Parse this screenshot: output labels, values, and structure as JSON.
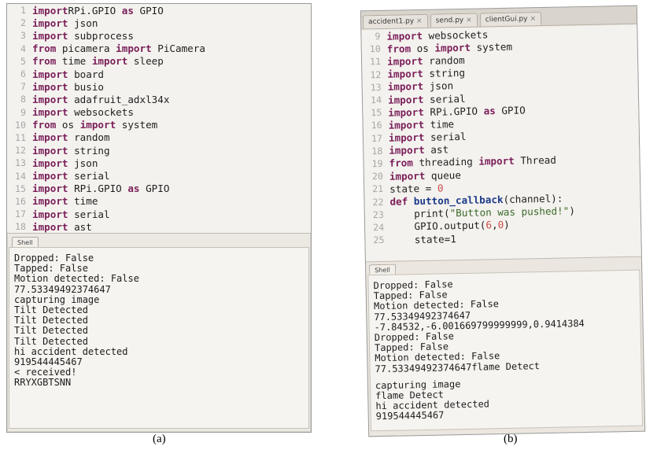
{
  "panel_a": {
    "code_lines": [
      {
        "n": "1",
        "t": [
          [
            "kw",
            "import"
          ],
          [
            "",
            "RPi.GPIO "
          ],
          [
            "kw",
            "as"
          ],
          [
            "",
            " GPIO"
          ]
        ]
      },
      {
        "n": "2",
        "t": [
          [
            "kw",
            "import"
          ],
          [
            "",
            " json"
          ]
        ]
      },
      {
        "n": "3",
        "t": [
          [
            "kw",
            "import"
          ],
          [
            "",
            " subprocess"
          ]
        ]
      },
      {
        "n": "4",
        "t": [
          [
            "kw",
            "from"
          ],
          [
            "",
            " picamera "
          ],
          [
            "kw",
            "import"
          ],
          [
            "",
            " PiCamera"
          ]
        ]
      },
      {
        "n": "5",
        "t": [
          [
            "kw",
            "from"
          ],
          [
            "",
            " time "
          ],
          [
            "kw",
            "import"
          ],
          [
            "",
            " sleep"
          ]
        ]
      },
      {
        "n": "6",
        "t": [
          [
            "kw",
            "import"
          ],
          [
            "",
            " board"
          ]
        ]
      },
      {
        "n": "7",
        "t": [
          [
            "kw",
            "import"
          ],
          [
            "",
            " busio"
          ]
        ]
      },
      {
        "n": "8",
        "t": [
          [
            "kw",
            "import"
          ],
          [
            "",
            " adafruit_adxl34x"
          ]
        ]
      },
      {
        "n": "9",
        "t": [
          [
            "kw",
            "import"
          ],
          [
            "",
            " websockets"
          ]
        ]
      },
      {
        "n": "10",
        "t": [
          [
            "kw",
            "from"
          ],
          [
            "",
            " os "
          ],
          [
            "kw",
            "import"
          ],
          [
            "",
            " system"
          ]
        ]
      },
      {
        "n": "11",
        "t": [
          [
            "kw",
            "import"
          ],
          [
            "",
            " random"
          ]
        ]
      },
      {
        "n": "12",
        "t": [
          [
            "kw",
            "import"
          ],
          [
            "",
            " string"
          ]
        ]
      },
      {
        "n": "13",
        "t": [
          [
            "kw",
            "import"
          ],
          [
            "",
            " json"
          ]
        ]
      },
      {
        "n": "14",
        "t": [
          [
            "kw",
            "import"
          ],
          [
            "",
            " serial"
          ]
        ]
      },
      {
        "n": "15",
        "t": [
          [
            "kw",
            "import"
          ],
          [
            "",
            " RPi.GPIO "
          ],
          [
            "kw",
            "as"
          ],
          [
            "",
            " GPIO"
          ]
        ]
      },
      {
        "n": "16",
        "t": [
          [
            "kw",
            "import"
          ],
          [
            "",
            " time"
          ]
        ]
      },
      {
        "n": "17",
        "t": [
          [
            "kw",
            "import"
          ],
          [
            "",
            " serial"
          ]
        ]
      },
      {
        "n": "18",
        "t": [
          [
            "kw",
            "import"
          ],
          [
            "",
            " ast"
          ]
        ]
      }
    ],
    "shell_tab": "Shell",
    "shell_output": [
      "Dropped: False",
      "Tapped: False",
      "Motion detected: False",
      "77.53349492374647",
      "capturing image",
      "Tilt Detected",
      "Tilt Detected",
      "Tilt Detected",
      "Tilt Detected",
      "hi accident detected",
      "919544445467",
      "< received!",
      "RRYXGBTSNN"
    ],
    "caption": "(a)"
  },
  "panel_b": {
    "tabs": [
      "accident1.py",
      "send.py",
      "clientGui.py"
    ],
    "tab_close": "×",
    "code_lines": [
      {
        "n": "9",
        "t": [
          [
            "kw",
            "import"
          ],
          [
            "",
            " websockets"
          ]
        ]
      },
      {
        "n": "10",
        "t": [
          [
            "kw",
            "from"
          ],
          [
            "",
            " os "
          ],
          [
            "kw",
            "import"
          ],
          [
            "",
            " system"
          ]
        ]
      },
      {
        "n": "11",
        "t": [
          [
            "kw",
            "import"
          ],
          [
            "",
            " random"
          ]
        ]
      },
      {
        "n": "12",
        "t": [
          [
            "kw",
            "import"
          ],
          [
            "",
            " string"
          ]
        ]
      },
      {
        "n": "13",
        "t": [
          [
            "kw",
            "import"
          ],
          [
            "",
            " json"
          ]
        ]
      },
      {
        "n": "14",
        "t": [
          [
            "kw",
            "import"
          ],
          [
            "",
            " serial"
          ]
        ]
      },
      {
        "n": "15",
        "t": [
          [
            "kw",
            "import"
          ],
          [
            "",
            " RPi.GPIO "
          ],
          [
            "kw",
            "as"
          ],
          [
            "",
            " GPIO"
          ]
        ]
      },
      {
        "n": "16",
        "t": [
          [
            "kw",
            "import"
          ],
          [
            "",
            " time"
          ]
        ]
      },
      {
        "n": "17",
        "t": [
          [
            "kw",
            "import"
          ],
          [
            "",
            " serial"
          ]
        ]
      },
      {
        "n": "18",
        "t": [
          [
            "kw",
            "import"
          ],
          [
            "",
            " ast"
          ]
        ]
      },
      {
        "n": "19",
        "t": [
          [
            "kw",
            "from"
          ],
          [
            "",
            " threading "
          ],
          [
            "kw",
            "import"
          ],
          [
            "",
            " Thread"
          ]
        ]
      },
      {
        "n": "20",
        "t": [
          [
            "kw",
            "import"
          ],
          [
            "",
            " queue"
          ]
        ]
      },
      {
        "n": "21",
        "t": [
          [
            "",
            "state = "
          ],
          [
            "num",
            "0"
          ]
        ]
      },
      {
        "n": "22",
        "t": [
          [
            "kw",
            "def"
          ],
          [
            "",
            " "
          ],
          [
            "fn",
            "button_callback"
          ],
          [
            "",
            "(channel):"
          ]
        ]
      },
      {
        "n": "23",
        "t": [
          [
            "",
            "    print("
          ],
          [
            "str",
            "\"Button was pushed!\""
          ],
          [
            "",
            ")"
          ]
        ]
      },
      {
        "n": "24",
        "t": [
          [
            "",
            "    GPIO.output("
          ],
          [
            "num",
            "6"
          ],
          [
            "",
            ","
          ],
          [
            "num",
            "0"
          ],
          [
            "",
            ")"
          ]
        ]
      },
      {
        "n": "25",
        "t": [
          [
            "",
            "    state=1"
          ]
        ]
      }
    ],
    "shell_tab": "Shell",
    "shell_output": [
      "Dropped: False",
      "Tapped: False",
      "Motion detected: False",
      "77.53349492374647",
      "-7.84532,-6.001669799999999,0.9414384",
      "Dropped: False",
      "Tapped: False",
      "Motion detected: False",
      "77.53349492374647flame Detect",
      "",
      "capturing image",
      "flame Detect",
      "hi accident detected",
      "919544445467"
    ],
    "caption": "(b)"
  }
}
